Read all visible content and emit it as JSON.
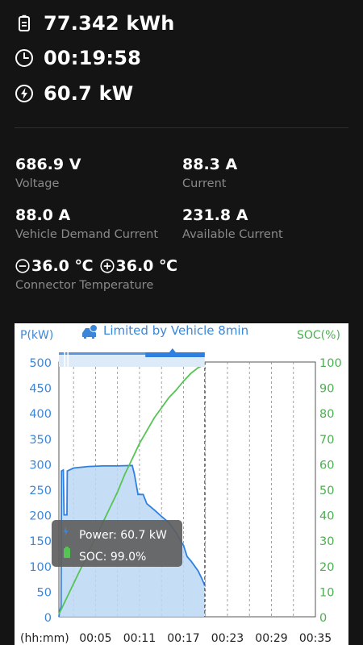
{
  "summary": {
    "energy": "77.342 kWh",
    "duration": "00:19:58",
    "power": "60.7 kW"
  },
  "metrics": {
    "voltage": {
      "value": "686.9 V",
      "label": "Voltage"
    },
    "current": {
      "value": "88.3 A",
      "label": "Current"
    },
    "demand": {
      "value": "88.0 A",
      "label": "Vehicle Demand Current"
    },
    "available": {
      "value": "231.8 A",
      "label": "Available Current"
    }
  },
  "temperature": {
    "value_minus": "36.0 ℃",
    "value_plus": "36.0 ℃",
    "label": "Connector Temperature"
  },
  "colors": {
    "background": "#141414",
    "power_line": "#2f7fe0",
    "power_fill": "#bcd7f5",
    "soc_line": "#56c454",
    "axis_left": "#3c86d8",
    "axis_right": "#4caf50"
  },
  "chart_data": {
    "type": "line",
    "banner": "Limited by Vehicle 8min",
    "y_left_label": "P(kW)",
    "y_right_label": "SOC(%)",
    "x_label": "(hh:mm)",
    "x_ticks": [
      "00:05",
      "00:11",
      "00:17",
      "00:23",
      "00:29",
      "00:35"
    ],
    "x_tick_minutes": [
      5,
      11,
      17,
      23,
      29,
      35
    ],
    "xlim_minutes": [
      0,
      35
    ],
    "ylim_left": [
      0,
      500
    ],
    "ylim_right": [
      0,
      100
    ],
    "y_left_ticks": [
      0,
      50,
      100,
      150,
      200,
      250,
      300,
      350,
      400,
      450,
      500
    ],
    "y_right_ticks": [
      0,
      10,
      20,
      30,
      40,
      50,
      60,
      70,
      80,
      90,
      100
    ],
    "cursor_minute": 19.9,
    "series": [
      {
        "name": "Power",
        "axis": "left",
        "x": [
          0,
          0.1,
          0.3,
          0.35,
          0.6,
          0.7,
          1.1,
          1.15,
          2,
          4,
          6,
          8,
          10,
          10.3,
          10.8,
          11.5,
          12,
          13,
          14,
          15,
          16,
          16.5,
          17,
          17.5,
          18,
          18.5,
          19,
          19.5,
          19.8,
          19.9
        ],
        "values": [
          0,
          10,
          20,
          286,
          288,
          200,
          200,
          286,
          292,
          295,
          296,
          296,
          297,
          280,
          240,
          240,
          222,
          210,
          197,
          185,
          165,
          152,
          140,
          118,
          110,
          100,
          90,
          75,
          65,
          60.7
        ]
      },
      {
        "name": "SOC",
        "axis": "right",
        "x": [
          0,
          1,
          2,
          3,
          4,
          5,
          6,
          7,
          8,
          9,
          10,
          11,
          12,
          13,
          14,
          15,
          16,
          17,
          18,
          19,
          19.9
        ],
        "values": [
          1,
          7,
          13,
          19,
          25,
          31,
          37,
          43,
          49,
          56,
          62,
          68,
          73,
          78,
          82,
          86,
          89,
          92.5,
          95.5,
          97.8,
          99
        ]
      }
    ],
    "tooltip": {
      "power_label": "Power",
      "power_value": "60.7 kW",
      "soc_label": "SOC",
      "soc_value": "99.0%"
    }
  }
}
